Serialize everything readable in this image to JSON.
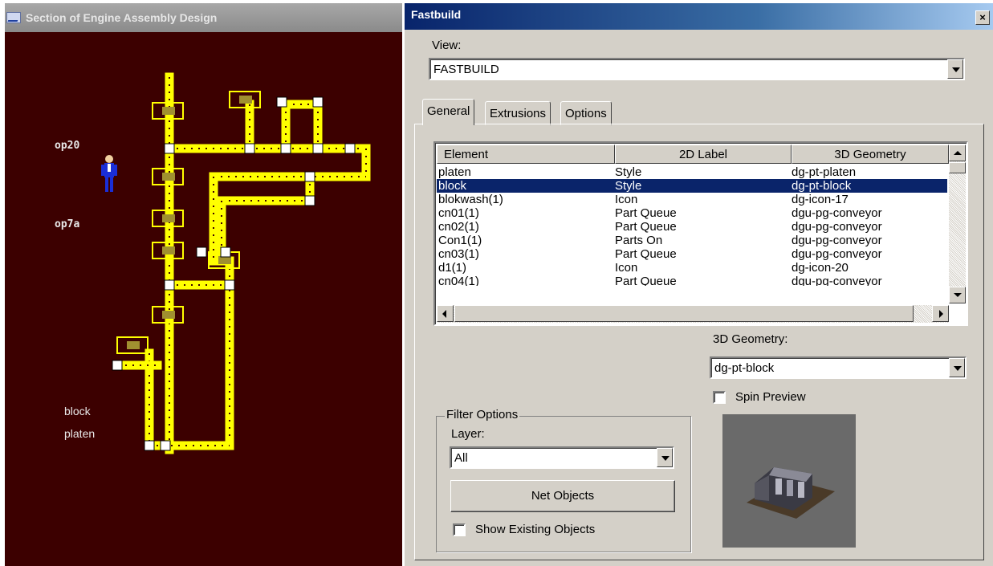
{
  "left_window": {
    "title": "Section of Engine Assembly Design",
    "labels": {
      "op20": "op20",
      "op7a": "op7a",
      "block": "block",
      "platen": "platen"
    }
  },
  "dialog": {
    "title": "Fastbuild",
    "close_label": "×",
    "view_label": "View:",
    "view_value": "FASTBUILD",
    "tabs": [
      {
        "label": "General",
        "active": true
      },
      {
        "label": "Extrusions",
        "active": false
      },
      {
        "label": "Options",
        "active": false
      }
    ],
    "list": {
      "columns": [
        "Element",
        "2D Label",
        "3D Geometry"
      ],
      "rows": [
        {
          "element": "platen",
          "label2d": "Style",
          "geometry3d": "dg-pt-platen",
          "selected": false
        },
        {
          "element": "block",
          "label2d": "Style",
          "geometry3d": "dg-pt-block",
          "selected": true
        },
        {
          "element": "blokwash(1)",
          "label2d": "Icon",
          "geometry3d": "dg-icon-17",
          "selected": false
        },
        {
          "element": "cn01(1)",
          "label2d": "Part Queue",
          "geometry3d": "dgu-pg-conveyor",
          "selected": false
        },
        {
          "element": "cn02(1)",
          "label2d": "Part Queue",
          "geometry3d": "dgu-pg-conveyor",
          "selected": false
        },
        {
          "element": "Con1(1)",
          "label2d": "Parts On",
          "geometry3d": "dgu-pg-conveyor",
          "selected": false
        },
        {
          "element": "cn03(1)",
          "label2d": "Part Queue",
          "geometry3d": "dgu-pg-conveyor",
          "selected": false
        },
        {
          "element": "d1(1)",
          "label2d": "Icon",
          "geometry3d": "dg-icon-20",
          "selected": false
        },
        {
          "element": "cn04(1)",
          "label2d": "Part Queue",
          "geometry3d": "dgu-pg-conveyor",
          "selected": false
        }
      ]
    },
    "geometry_label": "3D Geometry:",
    "geometry_value": "dg-pt-block",
    "spin_preview_label": "Spin Preview",
    "spin_preview_checked": false,
    "filter": {
      "legend": "Filter Options",
      "layer_label": "Layer:",
      "layer_value": "All",
      "net_objects_label": "Net Objects",
      "show_existing_label": "Show Existing Objects",
      "show_existing_checked": false
    }
  },
  "colors": {
    "canvas_bg": "#3c0000",
    "conveyor": "#ffff00",
    "selection": "#0a246a",
    "dialog_bg": "#d4d0c8"
  }
}
